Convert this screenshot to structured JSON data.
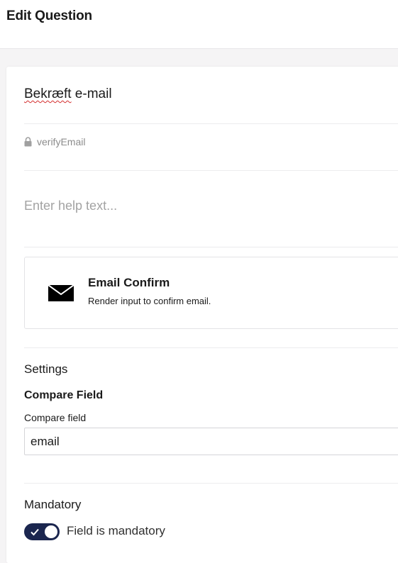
{
  "header": {
    "title": "Edit Question"
  },
  "question": {
    "name_misspelled_part": "Bekræft",
    "name_rest": " e-mail",
    "alias": "verifyEmail",
    "help_placeholder": "Enter help text..."
  },
  "editor": {
    "icon": "envelope-icon",
    "name": "Email Confirm",
    "description": "Render input to confirm email."
  },
  "settings": {
    "title": "Settings",
    "compare_heading": "Compare Field",
    "compare_label": "Compare field",
    "compare_value": "email"
  },
  "mandatory": {
    "title": "Mandatory",
    "toggle_label": "Field is mandatory",
    "toggle_on": true,
    "toggle_color": "#1b264f"
  }
}
